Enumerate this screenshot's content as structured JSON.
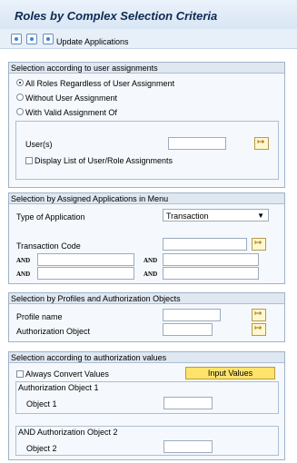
{
  "window": {
    "title": "Roles by Complex Selection Criteria"
  },
  "toolbar": {
    "action_label": "Update Applications",
    "icons": [
      "execute-icon",
      "copy-icon",
      "refresh-icon"
    ]
  },
  "section_user": {
    "header": "Selection according to user assignments",
    "options": [
      "All Roles Regardless of User Assignment",
      "Without User Assignment",
      "With Valid Assignment Of"
    ],
    "user_label": "User(s)",
    "display_list_label": "Display List of User/Role Assignments"
  },
  "section_apps": {
    "header": "Selection by Assigned Applications in Menu",
    "type_label": "Type of Application",
    "type_value": "Transaction",
    "transaction_code_label": "Transaction Code",
    "and_label": "AND"
  },
  "section_profiles": {
    "header": "Selection by Profiles and Authorization Objects",
    "profile_label": "Profile name",
    "auth_object_label": "Authorization Object"
  },
  "section_auth_values": {
    "header": "Selection according to authorization values",
    "always_convert_label": "Always Convert Values",
    "input_values_label": "Input Values",
    "auth_object_1_header": "Authorization Object 1",
    "object_1_label": "Object 1",
    "auth_object_2_header": "AND Authorization Object 2",
    "object_2_label": "Object 2"
  }
}
